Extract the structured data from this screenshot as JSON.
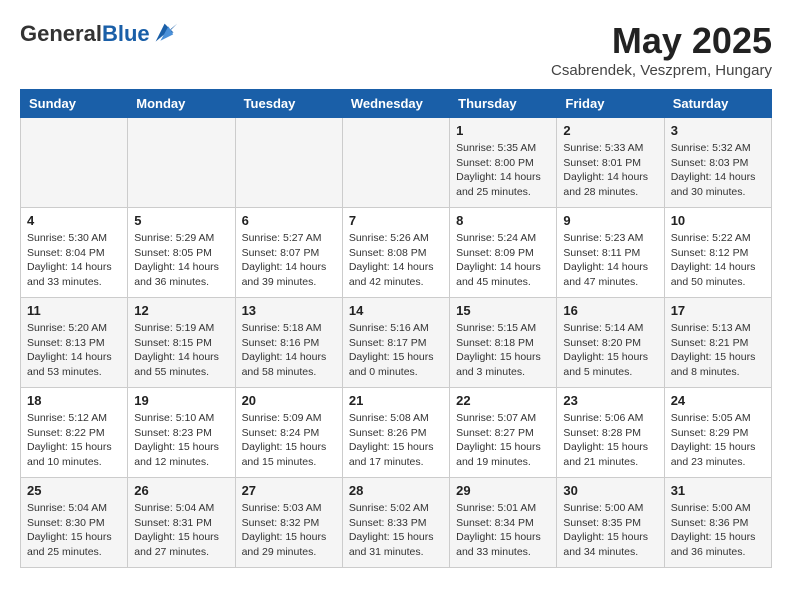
{
  "logo": {
    "general": "General",
    "blue": "Blue"
  },
  "header": {
    "month": "May 2025",
    "location": "Csabrendek, Veszprem, Hungary"
  },
  "weekdays": [
    "Sunday",
    "Monday",
    "Tuesday",
    "Wednesday",
    "Thursday",
    "Friday",
    "Saturday"
  ],
  "weeks": [
    [
      {
        "day": "",
        "content": ""
      },
      {
        "day": "",
        "content": ""
      },
      {
        "day": "",
        "content": ""
      },
      {
        "day": "",
        "content": ""
      },
      {
        "day": "1",
        "content": "Sunrise: 5:35 AM\nSunset: 8:00 PM\nDaylight: 14 hours\nand 25 minutes."
      },
      {
        "day": "2",
        "content": "Sunrise: 5:33 AM\nSunset: 8:01 PM\nDaylight: 14 hours\nand 28 minutes."
      },
      {
        "day": "3",
        "content": "Sunrise: 5:32 AM\nSunset: 8:03 PM\nDaylight: 14 hours\nand 30 minutes."
      }
    ],
    [
      {
        "day": "4",
        "content": "Sunrise: 5:30 AM\nSunset: 8:04 PM\nDaylight: 14 hours\nand 33 minutes."
      },
      {
        "day": "5",
        "content": "Sunrise: 5:29 AM\nSunset: 8:05 PM\nDaylight: 14 hours\nand 36 minutes."
      },
      {
        "day": "6",
        "content": "Sunrise: 5:27 AM\nSunset: 8:07 PM\nDaylight: 14 hours\nand 39 minutes."
      },
      {
        "day": "7",
        "content": "Sunrise: 5:26 AM\nSunset: 8:08 PM\nDaylight: 14 hours\nand 42 minutes."
      },
      {
        "day": "8",
        "content": "Sunrise: 5:24 AM\nSunset: 8:09 PM\nDaylight: 14 hours\nand 45 minutes."
      },
      {
        "day": "9",
        "content": "Sunrise: 5:23 AM\nSunset: 8:11 PM\nDaylight: 14 hours\nand 47 minutes."
      },
      {
        "day": "10",
        "content": "Sunrise: 5:22 AM\nSunset: 8:12 PM\nDaylight: 14 hours\nand 50 minutes."
      }
    ],
    [
      {
        "day": "11",
        "content": "Sunrise: 5:20 AM\nSunset: 8:13 PM\nDaylight: 14 hours\nand 53 minutes."
      },
      {
        "day": "12",
        "content": "Sunrise: 5:19 AM\nSunset: 8:15 PM\nDaylight: 14 hours\nand 55 minutes."
      },
      {
        "day": "13",
        "content": "Sunrise: 5:18 AM\nSunset: 8:16 PM\nDaylight: 14 hours\nand 58 minutes."
      },
      {
        "day": "14",
        "content": "Sunrise: 5:16 AM\nSunset: 8:17 PM\nDaylight: 15 hours\nand 0 minutes."
      },
      {
        "day": "15",
        "content": "Sunrise: 5:15 AM\nSunset: 8:18 PM\nDaylight: 15 hours\nand 3 minutes."
      },
      {
        "day": "16",
        "content": "Sunrise: 5:14 AM\nSunset: 8:20 PM\nDaylight: 15 hours\nand 5 minutes."
      },
      {
        "day": "17",
        "content": "Sunrise: 5:13 AM\nSunset: 8:21 PM\nDaylight: 15 hours\nand 8 minutes."
      }
    ],
    [
      {
        "day": "18",
        "content": "Sunrise: 5:12 AM\nSunset: 8:22 PM\nDaylight: 15 hours\nand 10 minutes."
      },
      {
        "day": "19",
        "content": "Sunrise: 5:10 AM\nSunset: 8:23 PM\nDaylight: 15 hours\nand 12 minutes."
      },
      {
        "day": "20",
        "content": "Sunrise: 5:09 AM\nSunset: 8:24 PM\nDaylight: 15 hours\nand 15 minutes."
      },
      {
        "day": "21",
        "content": "Sunrise: 5:08 AM\nSunset: 8:26 PM\nDaylight: 15 hours\nand 17 minutes."
      },
      {
        "day": "22",
        "content": "Sunrise: 5:07 AM\nSunset: 8:27 PM\nDaylight: 15 hours\nand 19 minutes."
      },
      {
        "day": "23",
        "content": "Sunrise: 5:06 AM\nSunset: 8:28 PM\nDaylight: 15 hours\nand 21 minutes."
      },
      {
        "day": "24",
        "content": "Sunrise: 5:05 AM\nSunset: 8:29 PM\nDaylight: 15 hours\nand 23 minutes."
      }
    ],
    [
      {
        "day": "25",
        "content": "Sunrise: 5:04 AM\nSunset: 8:30 PM\nDaylight: 15 hours\nand 25 minutes."
      },
      {
        "day": "26",
        "content": "Sunrise: 5:04 AM\nSunset: 8:31 PM\nDaylight: 15 hours\nand 27 minutes."
      },
      {
        "day": "27",
        "content": "Sunrise: 5:03 AM\nSunset: 8:32 PM\nDaylight: 15 hours\nand 29 minutes."
      },
      {
        "day": "28",
        "content": "Sunrise: 5:02 AM\nSunset: 8:33 PM\nDaylight: 15 hours\nand 31 minutes."
      },
      {
        "day": "29",
        "content": "Sunrise: 5:01 AM\nSunset: 8:34 PM\nDaylight: 15 hours\nand 33 minutes."
      },
      {
        "day": "30",
        "content": "Sunrise: 5:00 AM\nSunset: 8:35 PM\nDaylight: 15 hours\nand 34 minutes."
      },
      {
        "day": "31",
        "content": "Sunrise: 5:00 AM\nSunset: 8:36 PM\nDaylight: 15 hours\nand 36 minutes."
      }
    ]
  ],
  "colors": {
    "header_bg": "#1a5fa8",
    "header_text": "#ffffff",
    "odd_row": "#f5f5f5",
    "even_row": "#ffffff"
  }
}
